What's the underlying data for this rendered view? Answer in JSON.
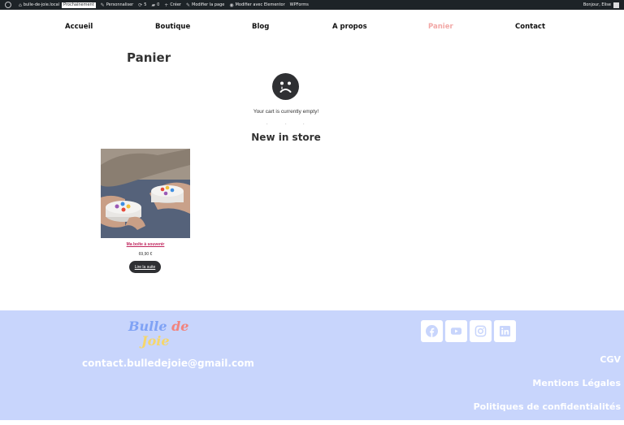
{
  "admin_bar": {
    "site_name": "bulle-de-joie.local",
    "badge": "Prochainement",
    "customize": "Personnaliser",
    "updates_count": "5",
    "comments_count": "0",
    "new": "Créer",
    "edit_page": "Modifier la page",
    "edit_elementor": "Modifier avec Elementor",
    "wpforms": "WPForms",
    "greeting": "Bonjour, Elise"
  },
  "nav": {
    "items": [
      "Accueil",
      "Boutique",
      "Blog",
      "A propos",
      "Panier",
      "Contact"
    ],
    "active": "Panier",
    "active_color": "#f2a7a5"
  },
  "page": {
    "title": "Panier",
    "empty_icon": "sad-face-icon",
    "empty_message": "Your cart is currently empty!",
    "new_in_store": "New in store"
  },
  "product": {
    "name": "Ma boîte à souvenir",
    "price": "69,90 €",
    "button": "Lire la suite",
    "name_color": "#c0265e"
  },
  "footer": {
    "logo_word1": "Bulle",
    "logo_word2": "de",
    "logo_word3": "Joie",
    "email": "contact.bulledejoie@gmail.com",
    "social_icons": [
      "facebook-icon",
      "youtube-icon",
      "instagram-icon",
      "linkedin-icon"
    ],
    "links": [
      "CGV",
      "Mentions Légales",
      "Politiques de confidentialités"
    ],
    "background": "#c8d5fc"
  }
}
